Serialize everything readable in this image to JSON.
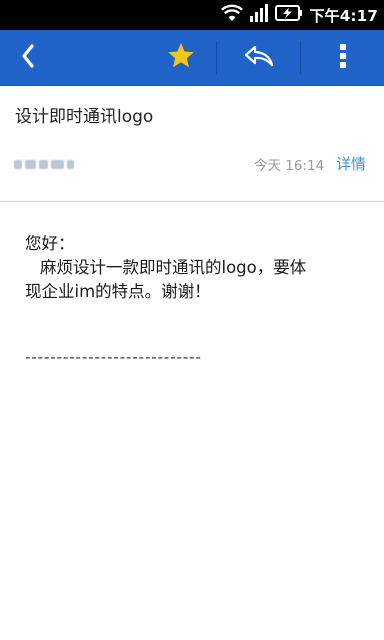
{
  "status_bar": {
    "time": "下午4:17",
    "icons": [
      "wifi-icon",
      "signal-icon",
      "battery-charging-icon"
    ]
  },
  "action_bar": {
    "accent_color": "#1f63c8",
    "icons": [
      "back-icon",
      "star-icon",
      "reply-icon",
      "overflow-menu-icon"
    ],
    "star_color": "#f5c518"
  },
  "email": {
    "subject": "设计即时通讯logo",
    "time": "今天 16:14",
    "details_link": "详情",
    "body_lines": [
      "您好：",
      "麻烦设计一款即时通讯的logo，要体",
      "现企业im的特点。谢谢！"
    ],
    "separator": "----------------------------"
  }
}
